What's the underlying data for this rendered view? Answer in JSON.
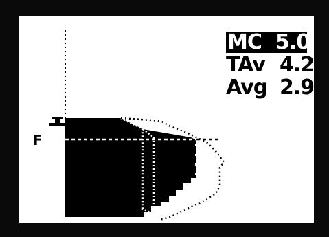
{
  "display": {
    "readouts": [
      {
        "label": "MC",
        "value": "5.0",
        "highlighted": true
      },
      {
        "label": "TAv",
        "value": "4.2",
        "highlighted": false
      },
      {
        "label": "Avg",
        "value": "2.9",
        "highlighted": false
      }
    ],
    "force_axis_label": "F",
    "colors": {
      "background": "#ffffff",
      "foreground": "#000000",
      "bezel": "#0a0a0a"
    },
    "icons": {
      "force_marker": "t-marker-icon"
    }
  }
}
